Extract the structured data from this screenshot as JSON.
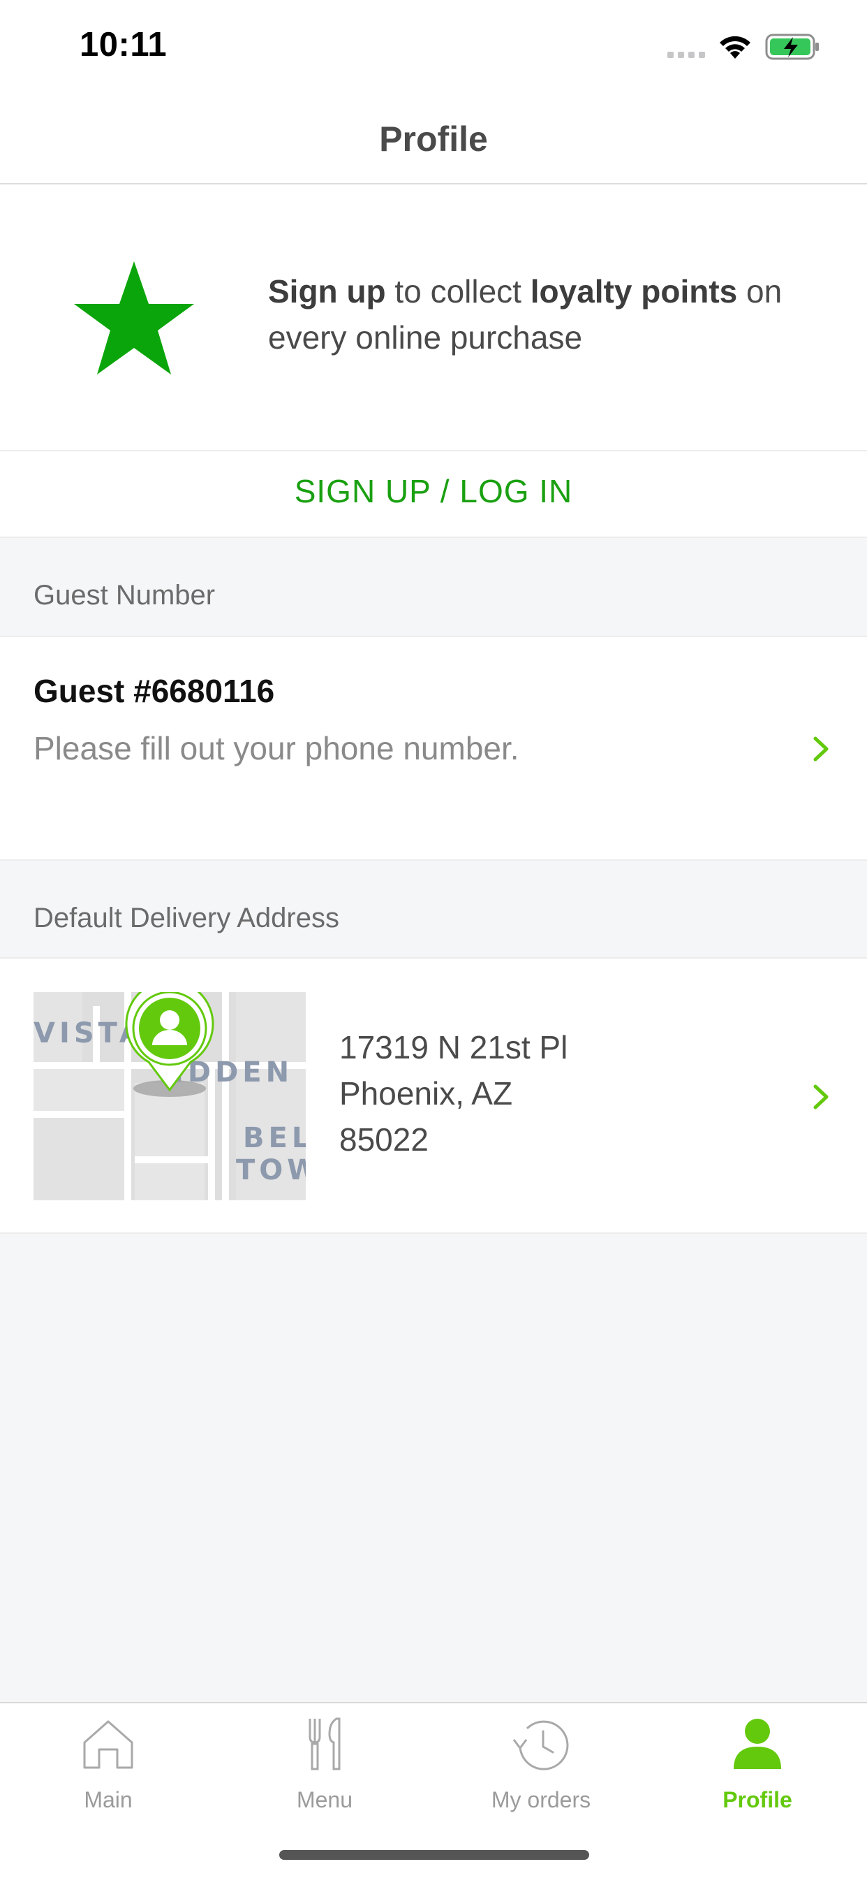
{
  "status_bar": {
    "time": "10:11"
  },
  "nav": {
    "title": "Profile"
  },
  "promo": {
    "part1": "Sign up",
    "part2": " to collect ",
    "part3": "loyalty points",
    "part4": " on every online purchase",
    "star_color": "#0aa50a",
    "signup_button": "SIGN UP / LOG IN"
  },
  "guest": {
    "section_label": "Guest Number",
    "title": "Guest #6680116",
    "subtitle": "Please fill out your phone number."
  },
  "address": {
    "section_label": "Default Delivery Address",
    "line1": "17319 N 21st Pl",
    "line2": "Phoenix, AZ",
    "line3": "85022",
    "map_labels": [
      "VISTA",
      "IDDEN",
      "BEL",
      "TOW"
    ]
  },
  "tabs": [
    {
      "label": "Main",
      "icon": "home-icon",
      "active": false
    },
    {
      "label": "Menu",
      "icon": "utensils-icon",
      "active": false
    },
    {
      "label": "My orders",
      "icon": "history-icon",
      "active": false
    },
    {
      "label": "Profile",
      "icon": "person-icon",
      "active": true
    }
  ],
  "colors": {
    "accent": "#63c90d",
    "signup": "#1aa011",
    "background": "#f5f6f8"
  }
}
